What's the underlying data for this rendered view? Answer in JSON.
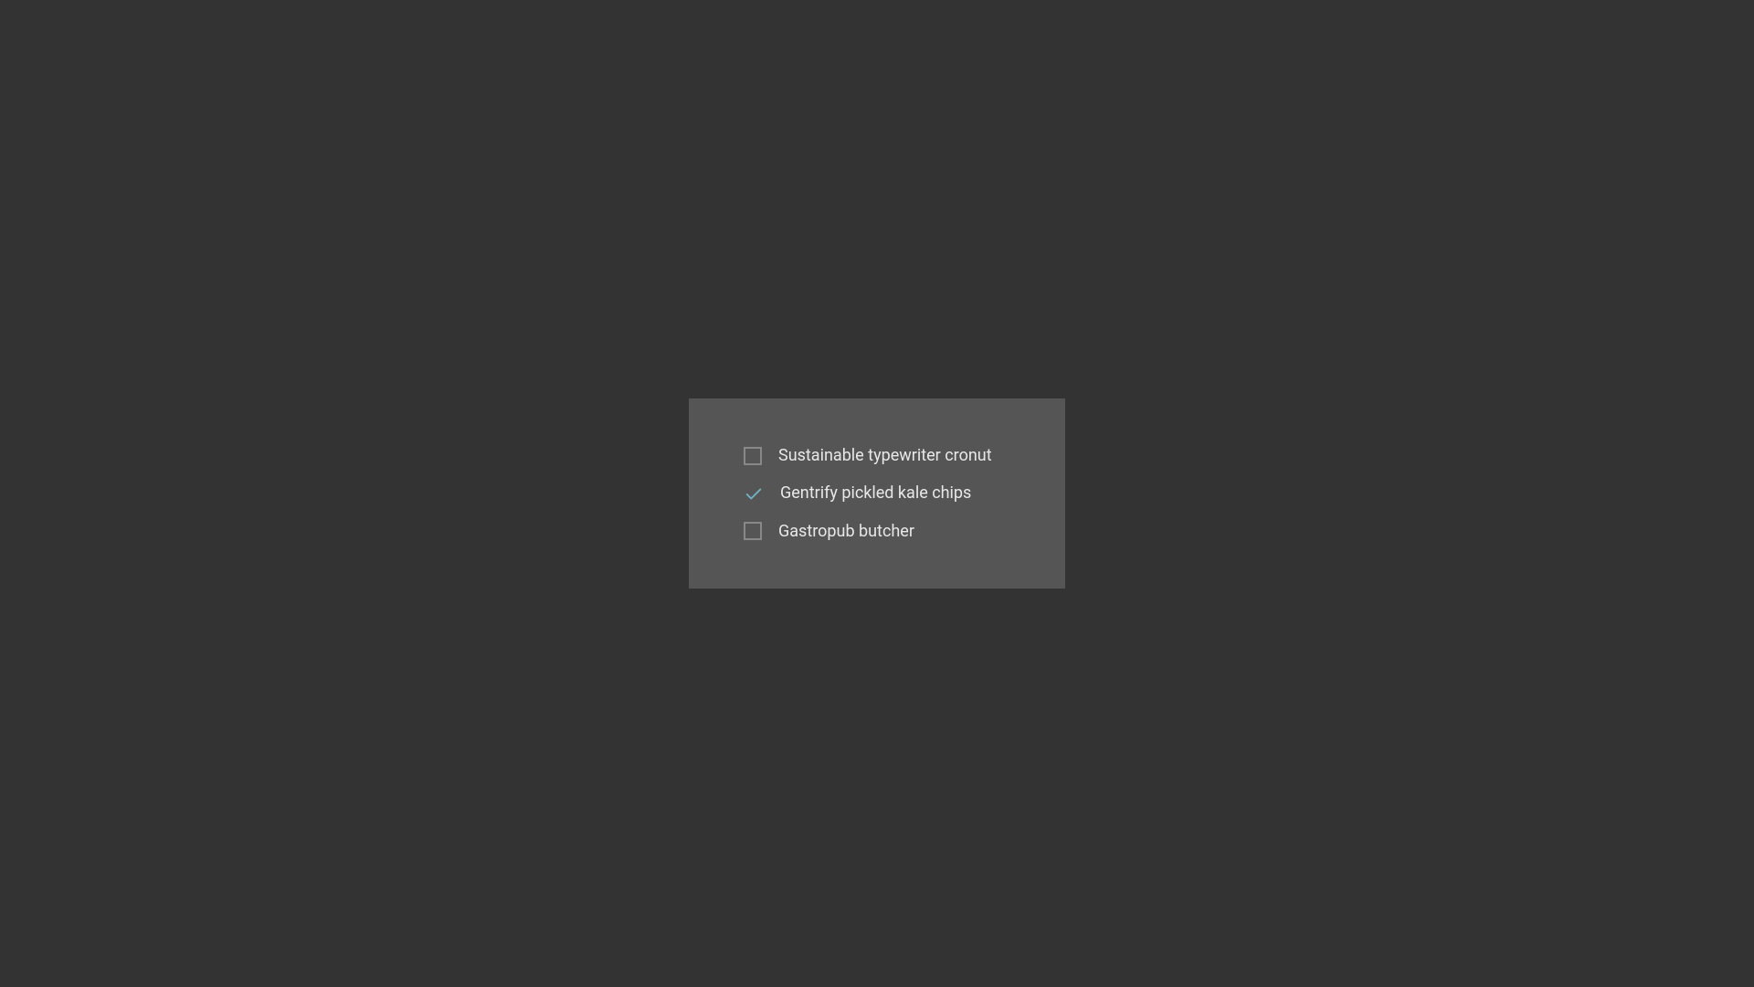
{
  "checkboxes": {
    "items": [
      {
        "label": "Sustainable typewriter cronut",
        "checked": false
      },
      {
        "label": "Gentrify pickled kale chips",
        "checked": true
      },
      {
        "label": "Gastropub butcher",
        "checked": false
      }
    ]
  },
  "colors": {
    "background": "#333333",
    "panel": "#555555",
    "border": "#888888",
    "text": "#e8e8e8",
    "check": "#6FB3C7"
  }
}
